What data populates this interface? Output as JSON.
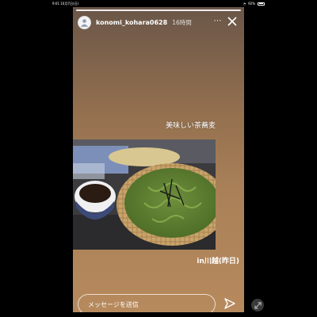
{
  "status_bar": {
    "time_date": "9:01  10月7日(日)",
    "wifi": "WiFi",
    "battery": "92%"
  },
  "story": {
    "username": "konomi_kohara0628",
    "time_ago": "16時間",
    "more_icon": "⋯",
    "caption_top": "美味しい茶蕎麦",
    "caption_bottom": "in川越(昨日)",
    "message_placeholder": "メッセージを送信"
  },
  "colors": {
    "background": "#000000",
    "story_gradient_top": "#6a5648",
    "story_gradient_bottom": "#b78a5d"
  }
}
